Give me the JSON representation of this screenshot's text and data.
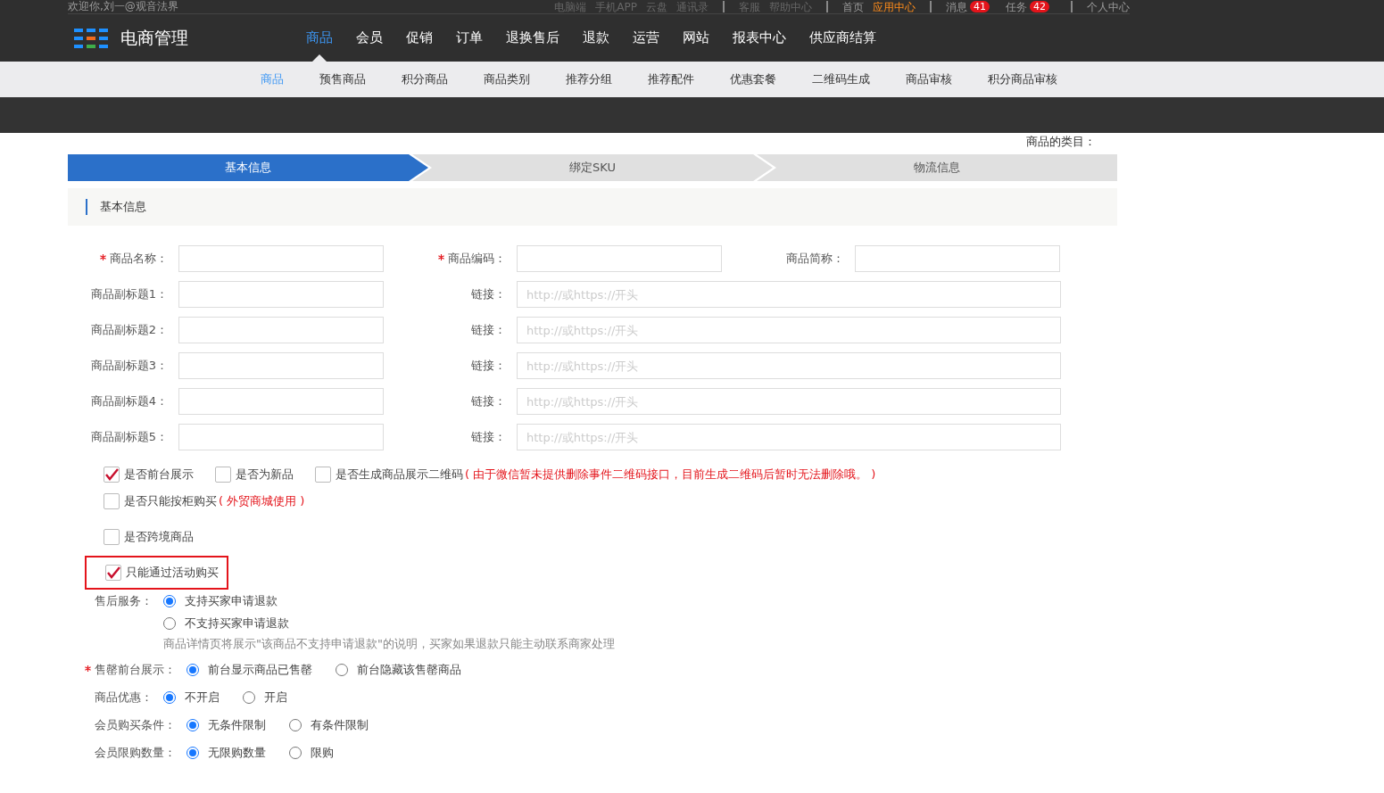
{
  "top_bar": {
    "welcome": "欢迎你,刘一@观音法界",
    "groups": [
      {
        "kind": "dim",
        "links": [
          {
            "label": "电脑端",
            "selected": false
          },
          {
            "label": "手机APP",
            "selected": false
          },
          {
            "label": "云盘",
            "selected": false
          },
          {
            "label": "通讯录",
            "selected": false
          }
        ]
      },
      {
        "kind": "dim",
        "links": [
          {
            "label": "客服",
            "selected": false
          },
          {
            "label": "帮助中心",
            "selected": false
          }
        ]
      },
      {
        "kind": "normal",
        "links": [
          {
            "label": "首页",
            "selected": false
          },
          {
            "label": "应用中心",
            "selected": true
          }
        ]
      },
      {
        "kind": "normal",
        "links": [
          {
            "label": "消息",
            "selected": false,
            "badge": "41"
          },
          {
            "label": "任务",
            "selected": false,
            "badge": "42"
          }
        ]
      },
      {
        "kind": "normal",
        "links": [
          {
            "label": "个人中心",
            "selected": false
          }
        ]
      }
    ]
  },
  "brand": "电商管理",
  "nav": [
    {
      "label": "商品",
      "selected": true
    },
    {
      "label": "会员",
      "selected": false
    },
    {
      "label": "促销",
      "selected": false
    },
    {
      "label": "订单",
      "selected": false
    },
    {
      "label": "退换售后",
      "selected": false
    },
    {
      "label": "退款",
      "selected": false
    },
    {
      "label": "运营",
      "selected": false
    },
    {
      "label": "网站",
      "selected": false
    },
    {
      "label": "报表中心",
      "selected": false
    },
    {
      "label": "供应商结算",
      "selected": false
    }
  ],
  "subnav": [
    {
      "label": "商品",
      "selected": true
    },
    {
      "label": "预售商品",
      "selected": false
    },
    {
      "label": "积分商品",
      "selected": false
    },
    {
      "label": "商品类别",
      "selected": false
    },
    {
      "label": "推荐分组",
      "selected": false
    },
    {
      "label": "推荐配件",
      "selected": false
    },
    {
      "label": "优惠套餐",
      "selected": false
    },
    {
      "label": "二维码生成",
      "selected": false
    },
    {
      "label": "商品审核",
      "selected": false
    },
    {
      "label": "积分商品审核",
      "selected": false
    }
  ],
  "category_label": "商品的类目：",
  "steps": [
    {
      "label": "基本信息",
      "selected": true
    },
    {
      "label": "绑定SKU",
      "selected": false
    },
    {
      "label": "物流信息",
      "selected": false
    }
  ],
  "section_title": "基本信息",
  "field_rows": [
    [
      {
        "label": "商品名称：",
        "required": true,
        "kind": "short"
      },
      {
        "label": "商品编码：",
        "required": true,
        "kind": "short"
      },
      {
        "label": "商品简称：",
        "required": false,
        "kind": "short"
      }
    ],
    [
      {
        "label": "商品副标题1：",
        "required": false,
        "kind": "short"
      },
      {
        "label": "链接：",
        "required": false,
        "kind": "long",
        "placeholder": "http://或https://开头"
      }
    ],
    [
      {
        "label": "商品副标题2：",
        "required": false,
        "kind": "short"
      },
      {
        "label": "链接：",
        "required": false,
        "kind": "long",
        "placeholder": "http://或https://开头"
      }
    ],
    [
      {
        "label": "商品副标题3：",
        "required": false,
        "kind": "short"
      },
      {
        "label": "链接：",
        "required": false,
        "kind": "long",
        "placeholder": "http://或https://开头"
      }
    ],
    [
      {
        "label": "商品副标题4：",
        "required": false,
        "kind": "short"
      },
      {
        "label": "链接：",
        "required": false,
        "kind": "long",
        "placeholder": "http://或https://开头"
      }
    ],
    [
      {
        "label": "商品副标题5：",
        "required": false,
        "kind": "short"
      },
      {
        "label": "链接：",
        "required": false,
        "kind": "long",
        "placeholder": "http://或https://开头"
      }
    ]
  ],
  "checkbox_rows": [
    [
      {
        "label": "是否前台展示",
        "checked": true,
        "highlighted": false
      },
      {
        "label": "是否为新品",
        "checked": false,
        "highlighted": false
      },
      {
        "label": "是否生成商品展示二维码",
        "checked": false,
        "highlighted": false,
        "note": "( 由于微信暂未提供删除事件二维码接口，目前生成二维码后暂时无法删除哦。 )"
      }
    ],
    [
      {
        "label": "是否只能按柜购买",
        "checked": false,
        "highlighted": false,
        "note": "( 外贸商城使用 )"
      }
    ],
    [
      {
        "label": "是否跨境商品",
        "checked": false,
        "highlighted": false
      }
    ],
    [
      {
        "label": "只能通过活动购买",
        "checked": true,
        "highlighted": true
      }
    ]
  ],
  "radio_groups": [
    {
      "label": "售后服务：",
      "required": false,
      "stacked": true,
      "options": [
        {
          "label": "支持买家申请退款",
          "selected": true
        },
        {
          "label": "不支持买家申请退款",
          "selected": false
        }
      ],
      "note": "商品详情页将展示\"该商品不支持申请退款\"的说明，买家如果退款只能主动联系商家处理"
    },
    {
      "label": "售罄前台展示：",
      "required": true,
      "stacked": false,
      "options": [
        {
          "label": "前台显示商品已售罄",
          "selected": true
        },
        {
          "label": "前台隐藏该售罄商品",
          "selected": false
        }
      ]
    },
    {
      "label": "商品优惠：",
      "required": false,
      "stacked": false,
      "options": [
        {
          "label": "不开启",
          "selected": true
        },
        {
          "label": "开启",
          "selected": false
        }
      ]
    },
    {
      "label": "会员购买条件：",
      "required": false,
      "stacked": false,
      "options": [
        {
          "label": "无条件限制",
          "selected": true
        },
        {
          "label": "有条件限制",
          "selected": false
        }
      ]
    },
    {
      "label": "会员限购数量：",
      "required": false,
      "stacked": false,
      "options": [
        {
          "label": "无限购数量",
          "selected": true
        },
        {
          "label": "限购",
          "selected": false
        }
      ]
    }
  ]
}
